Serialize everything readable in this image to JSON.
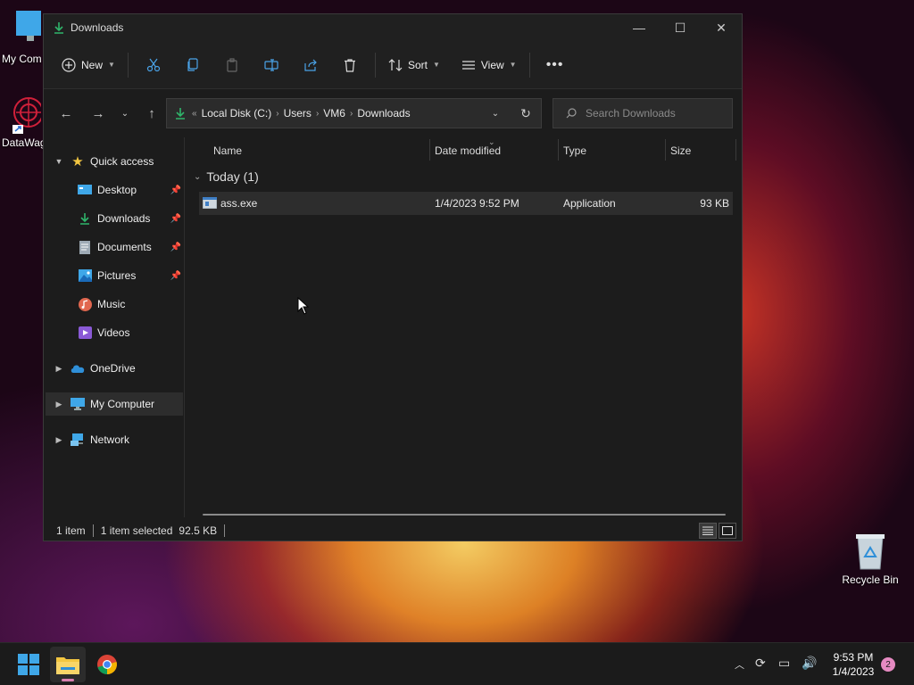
{
  "desktop": {
    "icons": [
      {
        "label": "My Com"
      },
      {
        "label": "DataWag"
      },
      {
        "label": "Recycle Bin"
      }
    ]
  },
  "window": {
    "title": "Downloads",
    "toolbar": {
      "new_label": "New",
      "sort_label": "Sort",
      "view_label": "View"
    },
    "address": {
      "overflow": "«",
      "crumbs": [
        "Local Disk (C:)",
        "Users",
        "VM6",
        "Downloads"
      ],
      "separator": "›"
    },
    "search": {
      "placeholder": "Search Downloads"
    },
    "sidebar": {
      "quick_access": "Quick access",
      "items": [
        {
          "label": "Desktop",
          "icon": "desktop-icon",
          "pinned": true
        },
        {
          "label": "Downloads",
          "icon": "download-icon",
          "pinned": true
        },
        {
          "label": "Documents",
          "icon": "documents-icon",
          "pinned": true
        },
        {
          "label": "Pictures",
          "icon": "pictures-icon",
          "pinned": true
        },
        {
          "label": "Music",
          "icon": "music-icon",
          "pinned": false
        },
        {
          "label": "Videos",
          "icon": "videos-icon",
          "pinned": false
        }
      ],
      "onedrive": "OneDrive",
      "my_computer": "My Computer",
      "network": "Network"
    },
    "columns": {
      "name": "Name",
      "date_modified": "Date modified",
      "type": "Type",
      "size": "Size"
    },
    "group_label": "Today (1)",
    "files": [
      {
        "name": "ass.exe",
        "date": "1/4/2023 9:52 PM",
        "type": "Application",
        "size": "93 KB"
      }
    ],
    "status": {
      "count": "1 item",
      "selected": "1 item selected",
      "selected_size": "92.5 KB"
    }
  },
  "taskbar": {
    "time": "9:53 PM",
    "date": "1/4/2023",
    "notifications": "2"
  },
  "colors": {
    "accent_download": "#2fb56b",
    "window_bg": "#1c1c1c",
    "selection_bg": "#2d2d2d"
  }
}
